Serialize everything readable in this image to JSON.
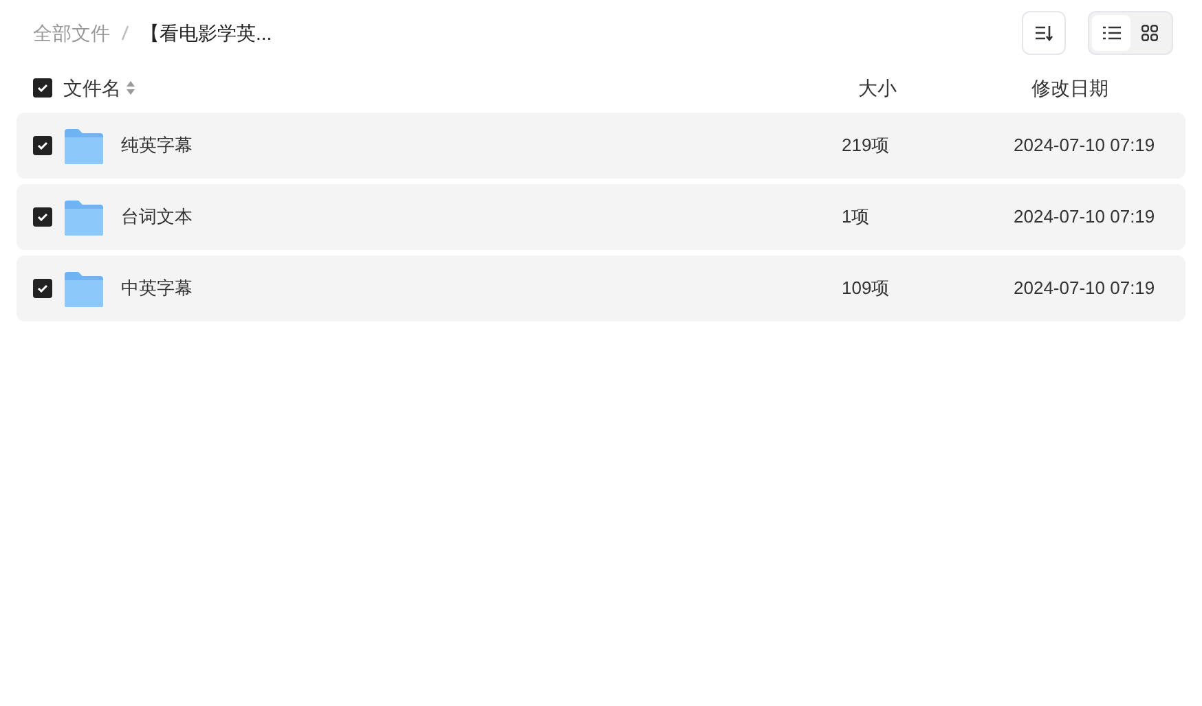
{
  "breadcrumb": [
    {
      "label": "全部文件",
      "current": false
    },
    {
      "label": "【看电影学英...",
      "current": true
    }
  ],
  "view_toggle": [
    {
      "kind": "list",
      "selected": true
    },
    {
      "kind": "grid",
      "selected": false
    }
  ],
  "table": {
    "all_checked": true,
    "columns": [
      "文件名",
      "大小",
      "修改日期"
    ],
    "rows": [
      {
        "name": "纯英字幕",
        "size": "219项",
        "modified": "2024-07-10 07:19",
        "checked": true
      },
      {
        "name": "台词文本",
        "size": "1项",
        "modified": "2024-07-10 07:19",
        "checked": true
      },
      {
        "name": "中英字幕",
        "size": "109项",
        "modified": "2024-07-10 07:19",
        "checked": true
      }
    ]
  }
}
